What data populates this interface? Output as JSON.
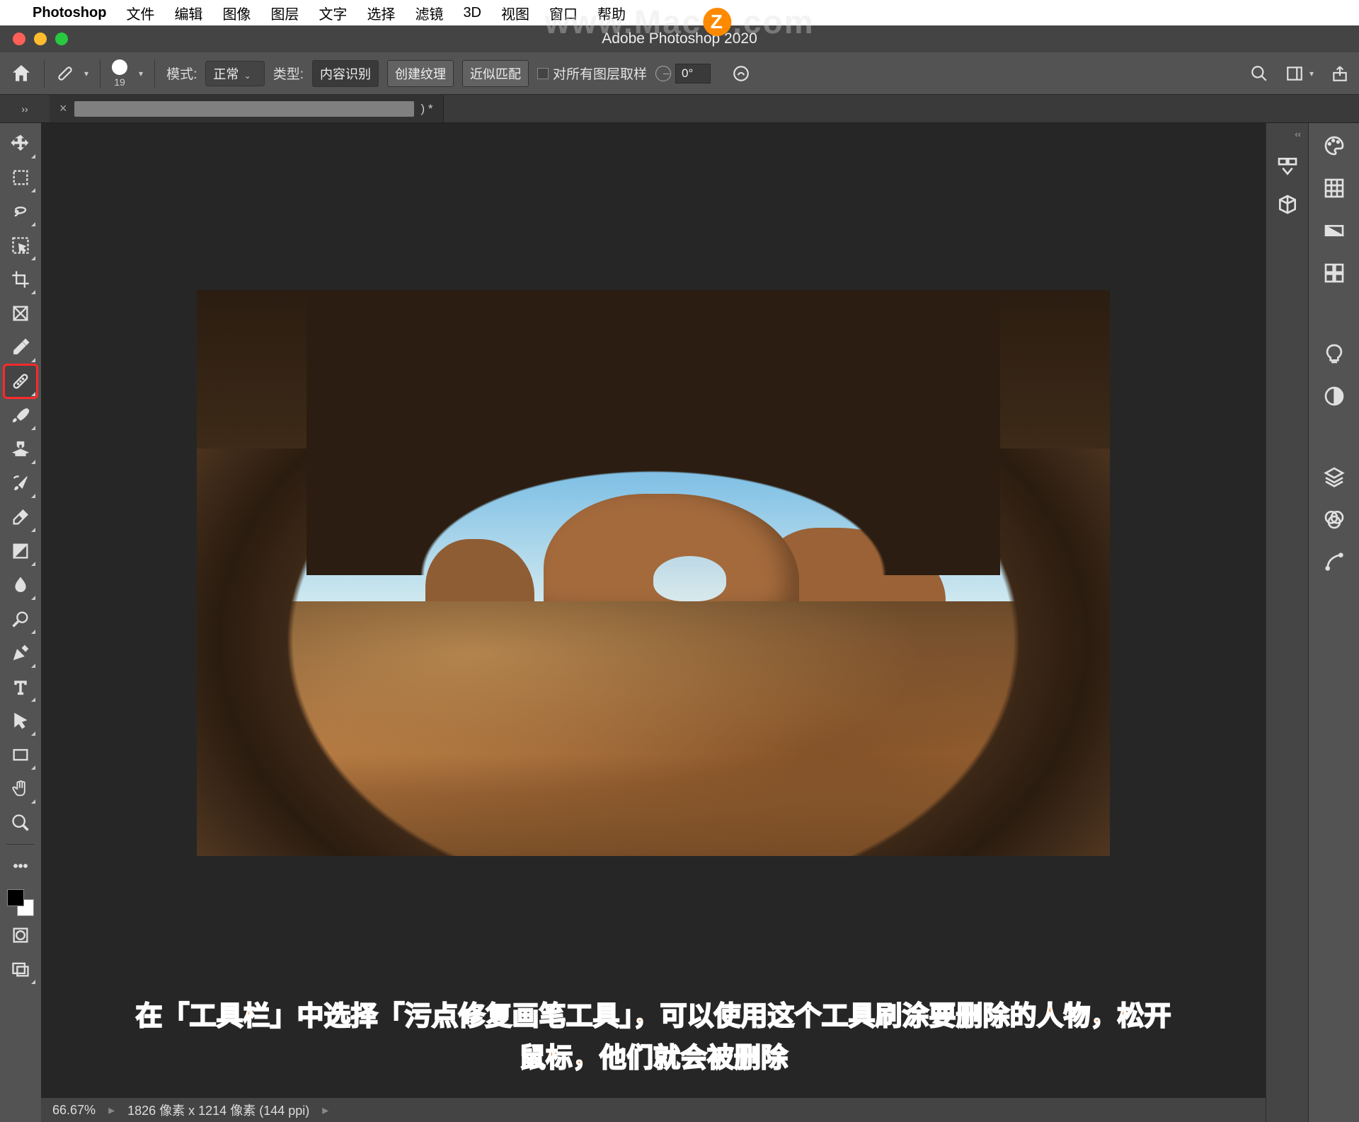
{
  "mac_menu": {
    "app_name": "Photoshop",
    "items": [
      "文件",
      "编辑",
      "图像",
      "图层",
      "文字",
      "选择",
      "滤镜",
      "3D",
      "视图",
      "窗口",
      "帮助"
    ]
  },
  "watermark": {
    "prefix": "www.Mac",
    "badge": "Z",
    "suffix": ".com"
  },
  "window_title": "Adobe Photoshop 2020",
  "options": {
    "brush_size": "19",
    "mode_label": "模式:",
    "mode_value": "正常",
    "type_label": "类型:",
    "btn_content_aware": "内容识别",
    "btn_create_texture": "创建纹理",
    "btn_proximity": "近似匹配",
    "sample_all_label": "对所有图层取样",
    "angle_value": "0°"
  },
  "document_tab": {
    "suffix": ") *"
  },
  "right_mini_header": "‹‹",
  "left_expand": "››",
  "annotation_line1": "在「工具栏」中选择「污点修复画笔工具」，可以使用这个工具刷涂要删除的人物，松开",
  "annotation_line2": "鼠标，他们就会被删除",
  "status": {
    "zoom": "66.67%",
    "doc_info": "1826 像素 x 1214 像素 (144 ppi)"
  },
  "tools": [
    "move-tool",
    "rectangular-marquee-tool",
    "lasso-tool",
    "object-selection-tool",
    "crop-tool",
    "frame-tool",
    "eyedropper-tool",
    "spot-healing-brush-tool",
    "brush-tool",
    "clone-stamp-tool",
    "history-brush-tool",
    "eraser-tool",
    "gradient-tool",
    "blur-tool",
    "dodge-tool",
    "pen-tool",
    "type-tool",
    "path-selection-tool",
    "rectangle-tool",
    "hand-tool",
    "zoom-tool"
  ]
}
